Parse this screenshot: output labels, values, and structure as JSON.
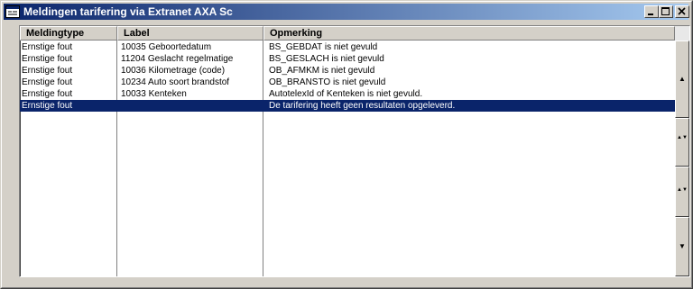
{
  "window": {
    "title": "Meldingen tarifering via Extranet AXA Sc",
    "icon": "app-window-icon",
    "controls": {
      "minimize_icon": "minimize-icon",
      "maximize_icon": "maximize-icon",
      "close_icon": "close-icon"
    }
  },
  "list": {
    "columns": [
      "Meldingtype",
      "Label",
      "Opmerking"
    ],
    "rows": [
      {
        "type": "Ernstige fout",
        "label": "10035 Geboortedatum",
        "remark": "BS_GEBDAT is niet gevuld"
      },
      {
        "type": "Ernstige fout",
        "label": "11204 Geslacht regelmatige",
        "remark": "BS_GESLACH is niet gevuld"
      },
      {
        "type": "Ernstige fout",
        "label": "10036 Kilometrage (code)",
        "remark": "OB_AFMKM is niet gevuld"
      },
      {
        "type": "Ernstige fout",
        "label": "10234 Auto soort brandstof",
        "remark": "OB_BRANSTO is niet gevuld"
      },
      {
        "type": "Ernstige fout",
        "label": "10033 Kenteken",
        "remark": "AutotelexId of Kenteken is niet gevuld."
      },
      {
        "type": "Ernstige fout",
        "label": "",
        "remark": "De tarifering heeft geen resultaten opgeleverd.",
        "selected": true
      }
    ]
  },
  "scrollbar": {
    "buttons": [
      {
        "name": "scroll-up-button",
        "glyph": "▲"
      },
      {
        "name": "scroll-page-up-button",
        "glyph": "▲▼"
      },
      {
        "name": "scroll-page-down-button",
        "glyph": "▲▼"
      },
      {
        "name": "scroll-down-button",
        "glyph": "▼"
      }
    ]
  }
}
